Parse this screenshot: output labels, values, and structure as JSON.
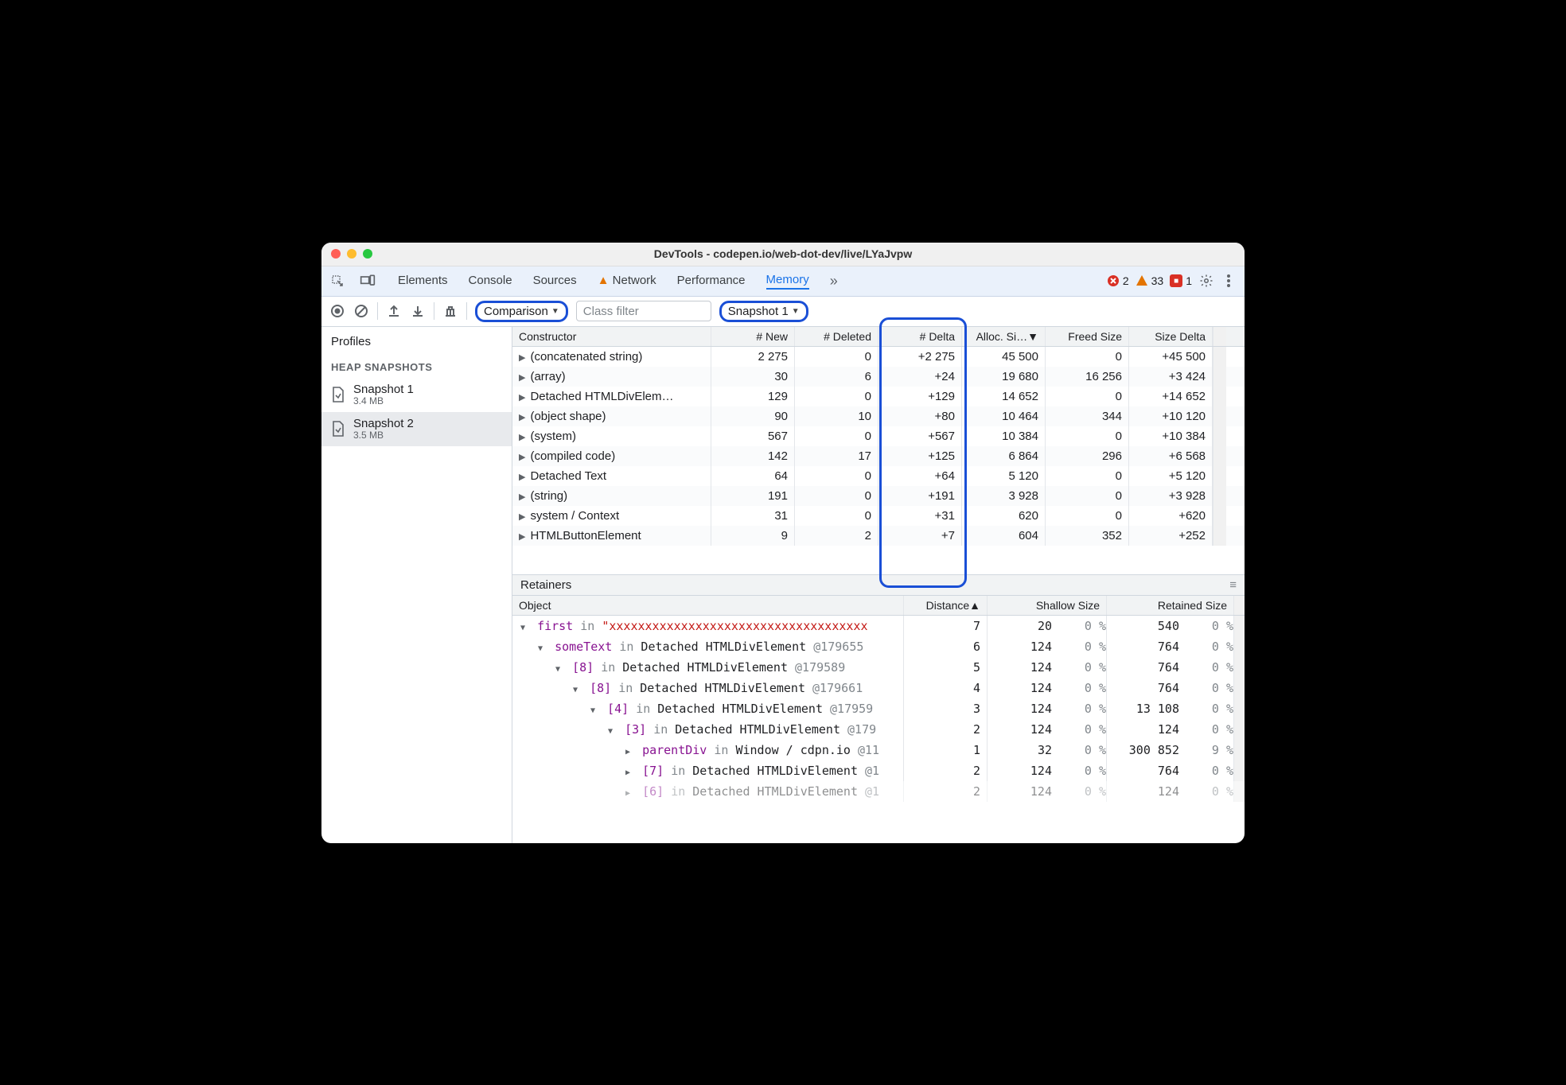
{
  "window_title": "DevTools - codepen.io/web-dot-dev/live/LYaJvpw",
  "tabs": [
    "Elements",
    "Console",
    "Sources",
    "Network",
    "Performance",
    "Memory"
  ],
  "active_tab": "Memory",
  "network_warning": true,
  "status": {
    "errors": 2,
    "warnings": 33,
    "issues": 1
  },
  "toolbar": {
    "view_mode": "Comparison",
    "class_filter_placeholder": "Class filter",
    "baseline": "Snapshot 1"
  },
  "sidebar": {
    "title": "Profiles",
    "group": "HEAP SNAPSHOTS",
    "snapshots": [
      {
        "name": "Snapshot 1",
        "size": "3.4 MB"
      },
      {
        "name": "Snapshot 2",
        "size": "3.5 MB"
      }
    ],
    "selected": 1
  },
  "columns": [
    "Constructor",
    "# New",
    "# Deleted",
    "# Delta",
    "Alloc. Si…",
    "Freed Size",
    "Size Delta"
  ],
  "alloc_sort_desc": true,
  "rows": [
    {
      "c": "(concatenated string)",
      "new": "2 275",
      "del": "0",
      "delta": "+2 275",
      "alloc": "45 500",
      "freed": "0",
      "sdelta": "+45 500"
    },
    {
      "c": "(array)",
      "new": "30",
      "del": "6",
      "delta": "+24",
      "alloc": "19 680",
      "freed": "16 256",
      "sdelta": "+3 424"
    },
    {
      "c": "Detached HTMLDivElem…",
      "new": "129",
      "del": "0",
      "delta": "+129",
      "alloc": "14 652",
      "freed": "0",
      "sdelta": "+14 652"
    },
    {
      "c": "(object shape)",
      "new": "90",
      "del": "10",
      "delta": "+80",
      "alloc": "10 464",
      "freed": "344",
      "sdelta": "+10 120"
    },
    {
      "c": "(system)",
      "new": "567",
      "del": "0",
      "delta": "+567",
      "alloc": "10 384",
      "freed": "0",
      "sdelta": "+10 384"
    },
    {
      "c": "(compiled code)",
      "new": "142",
      "del": "17",
      "delta": "+125",
      "alloc": "6 864",
      "freed": "296",
      "sdelta": "+6 568"
    },
    {
      "c": "Detached Text",
      "new": "64",
      "del": "0",
      "delta": "+64",
      "alloc": "5 120",
      "freed": "0",
      "sdelta": "+5 120"
    },
    {
      "c": "(string)",
      "new": "191",
      "del": "0",
      "delta": "+191",
      "alloc": "3 928",
      "freed": "0",
      "sdelta": "+3 928"
    },
    {
      "c": "system / Context",
      "new": "31",
      "del": "0",
      "delta": "+31",
      "alloc": "620",
      "freed": "0",
      "sdelta": "+620"
    },
    {
      "c": "HTMLButtonElement",
      "new": "9",
      "del": "2",
      "delta": "+7",
      "alloc": "604",
      "freed": "352",
      "sdelta": "+252"
    }
  ],
  "retainers": {
    "title": "Retainers",
    "columns": [
      "Object",
      "Distance",
      "Shallow Size",
      "Retained Size"
    ],
    "sort_col": "Distance",
    "rows": [
      {
        "indent": 0,
        "open": true,
        "prop": "first",
        "in": "in",
        "target": "\"xxxxxxxxxxxxxxxxxxxxxxxxxxxxxxxxxxxx",
        "target_is_string": true,
        "dist": "7",
        "shallow": "20",
        "shp": "0 %",
        "ret": "540",
        "rp": "0 %"
      },
      {
        "indent": 1,
        "open": true,
        "prop": "someText",
        "in": "in",
        "target": "Detached HTMLDivElement",
        "id": "@179655",
        "dist": "6",
        "shallow": "124",
        "shp": "0 %",
        "ret": "764",
        "rp": "0 %"
      },
      {
        "indent": 2,
        "open": true,
        "prop": "[8]",
        "in": "in",
        "target": "Detached HTMLDivElement",
        "id": "@179589",
        "dist": "5",
        "shallow": "124",
        "shp": "0 %",
        "ret": "764",
        "rp": "0 %"
      },
      {
        "indent": 3,
        "open": true,
        "prop": "[8]",
        "in": "in",
        "target": "Detached HTMLDivElement",
        "id": "@179661",
        "dist": "4",
        "shallow": "124",
        "shp": "0 %",
        "ret": "764",
        "rp": "0 %"
      },
      {
        "indent": 4,
        "open": true,
        "prop": "[4]",
        "in": "in",
        "target": "Detached HTMLDivElement",
        "id": "@17959",
        "dist": "3",
        "shallow": "124",
        "shp": "0 %",
        "ret": "13 108",
        "rp": "0 %"
      },
      {
        "indent": 5,
        "open": true,
        "prop": "[3]",
        "in": "in",
        "target": "Detached HTMLDivElement",
        "id": "@179",
        "dist": "2",
        "shallow": "124",
        "shp": "0 %",
        "ret": "124",
        "rp": "0 %"
      },
      {
        "indent": 6,
        "open": false,
        "prop": "parentDiv",
        "in": "in",
        "target": "Window / cdpn.io",
        "id": "@11",
        "dist": "1",
        "shallow": "32",
        "shp": "0 %",
        "ret": "300 852",
        "rp": "9 %"
      },
      {
        "indent": 6,
        "open": false,
        "prop": "[7]",
        "in": "in",
        "target": "Detached HTMLDivElement",
        "id": "@1",
        "dist": "2",
        "shallow": "124",
        "shp": "0 %",
        "ret": "764",
        "rp": "0 %"
      },
      {
        "indent": 6,
        "open": false,
        "prop": "[6]",
        "in": "in",
        "target": "Detached HTMLDivElement",
        "id": "@1",
        "dist": "2",
        "shallow": "124",
        "shp": "0 %",
        "ret": "124",
        "rp": "0 %",
        "faded": true
      }
    ]
  }
}
